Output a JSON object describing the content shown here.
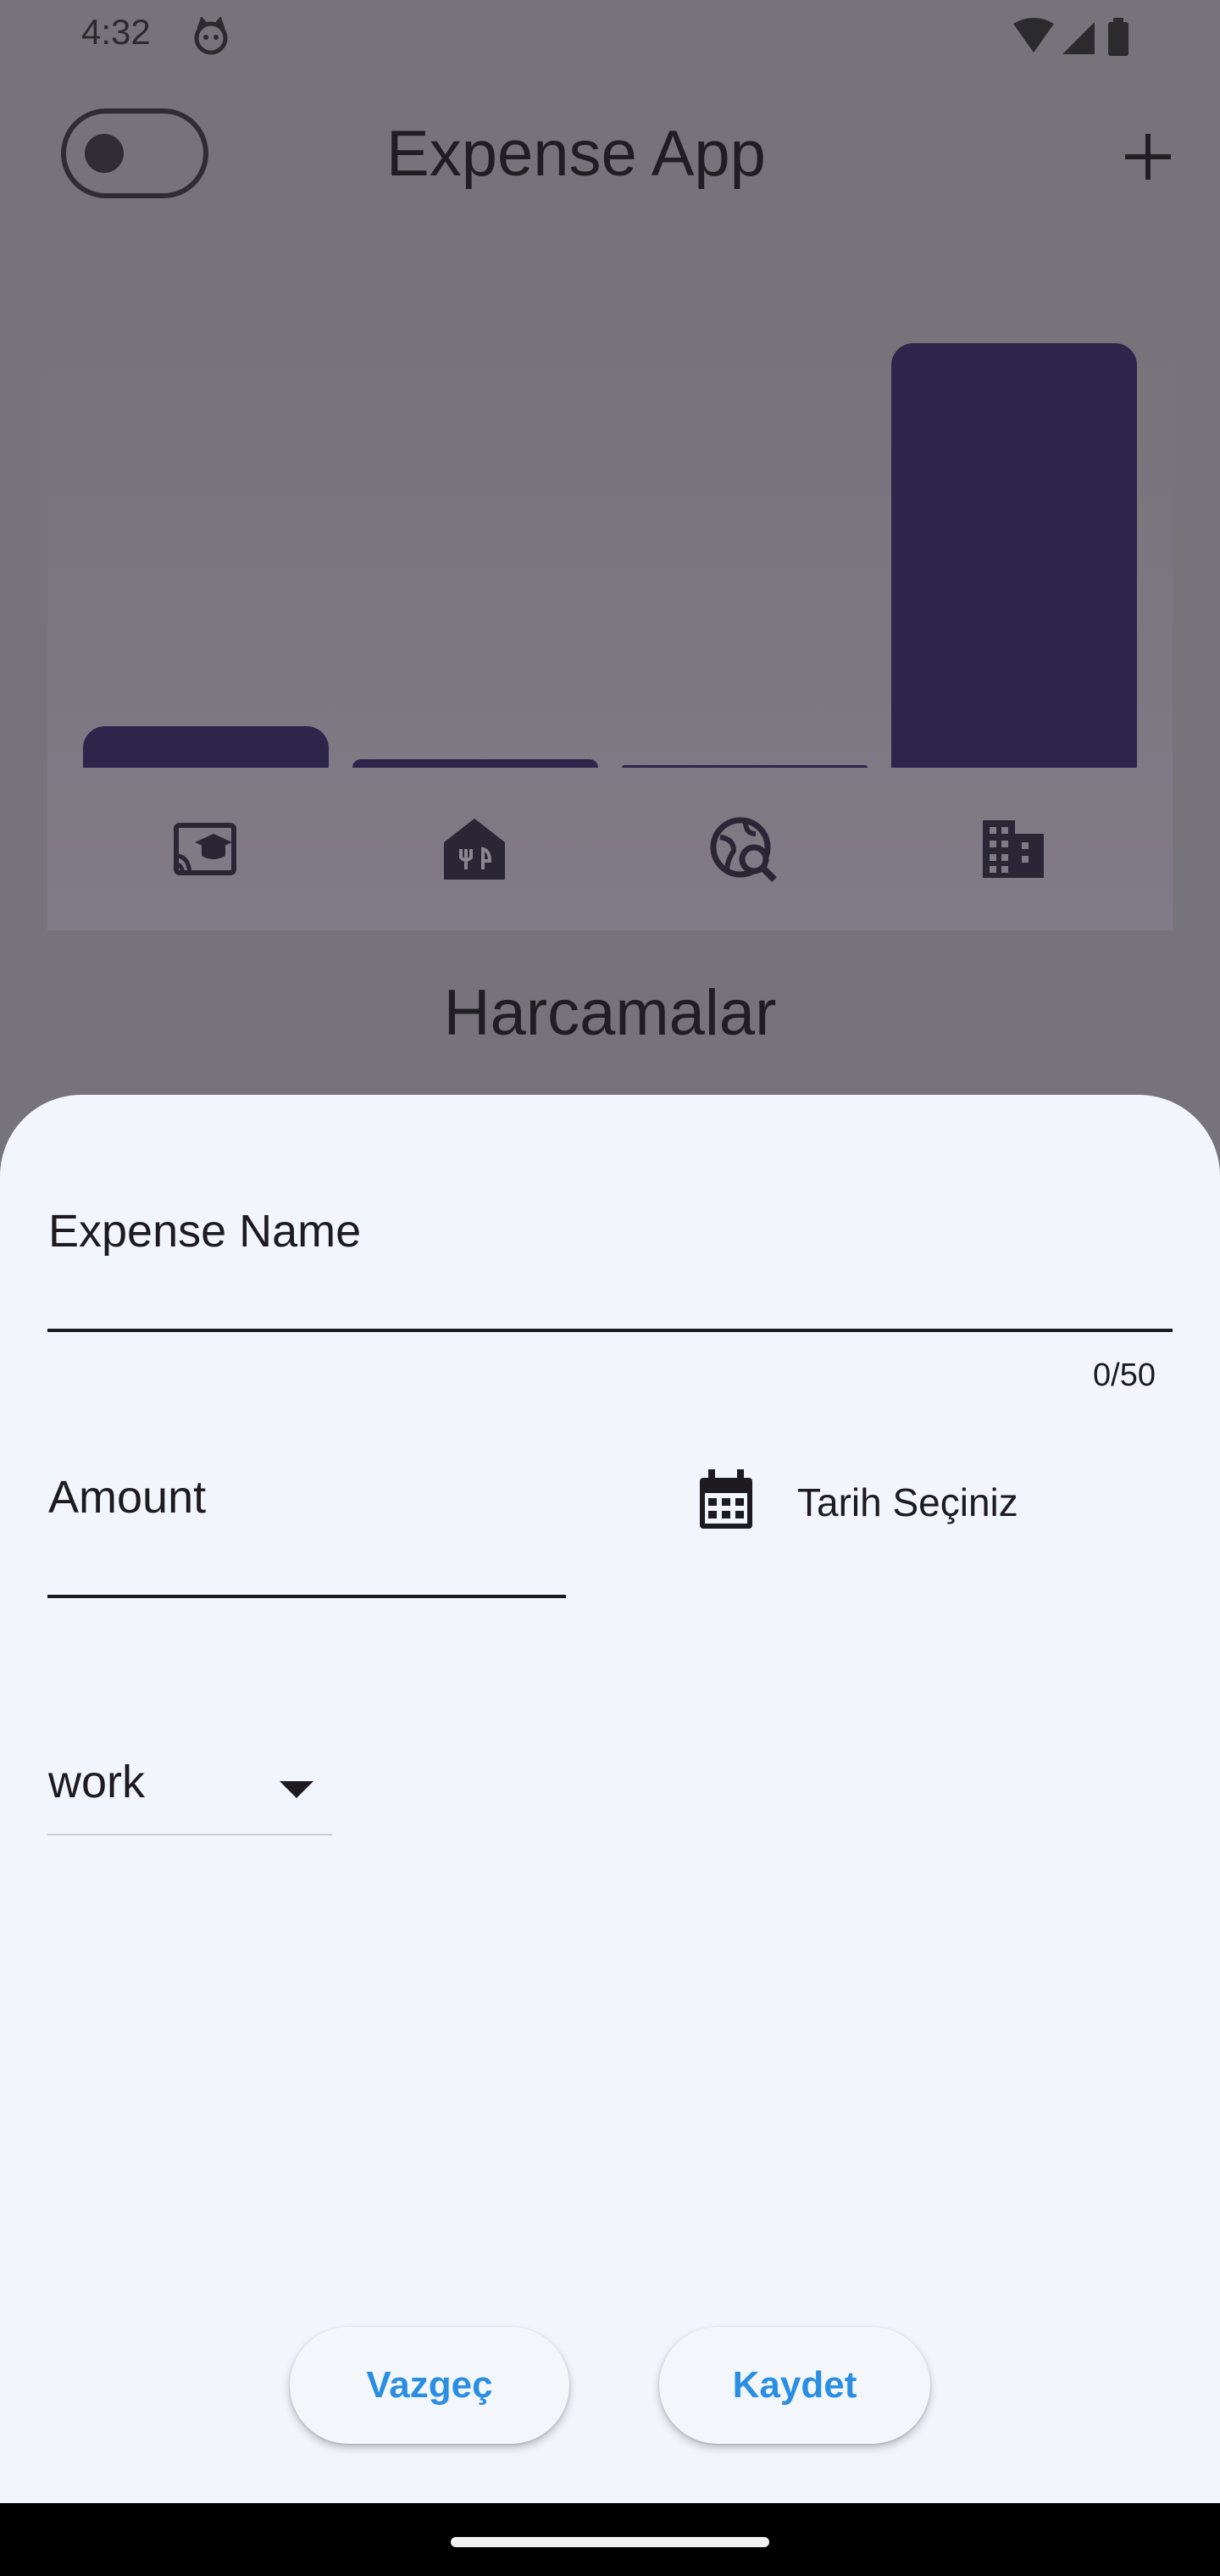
{
  "status_bar": {
    "time": "4:32"
  },
  "app_bar": {
    "title": "Expense App",
    "theme_toggle_on": false
  },
  "chart": {
    "bar_color": "#2e254b",
    "categories": [
      "leisure",
      "food",
      "travel",
      "work"
    ],
    "relative_values": [
      0.097,
      0.021,
      0.006,
      1.0
    ]
  },
  "section": {
    "title": "Harcamalar"
  },
  "sheet": {
    "expense_name_label": "Expense Name",
    "name_counter": "0/50",
    "amount_label": "Amount",
    "date_label": "Tarih Seçiniz",
    "category_value": "work",
    "cancel_label": "Vazgeç",
    "save_label": "Kaydet",
    "accent_color": "#2a8ee2"
  }
}
